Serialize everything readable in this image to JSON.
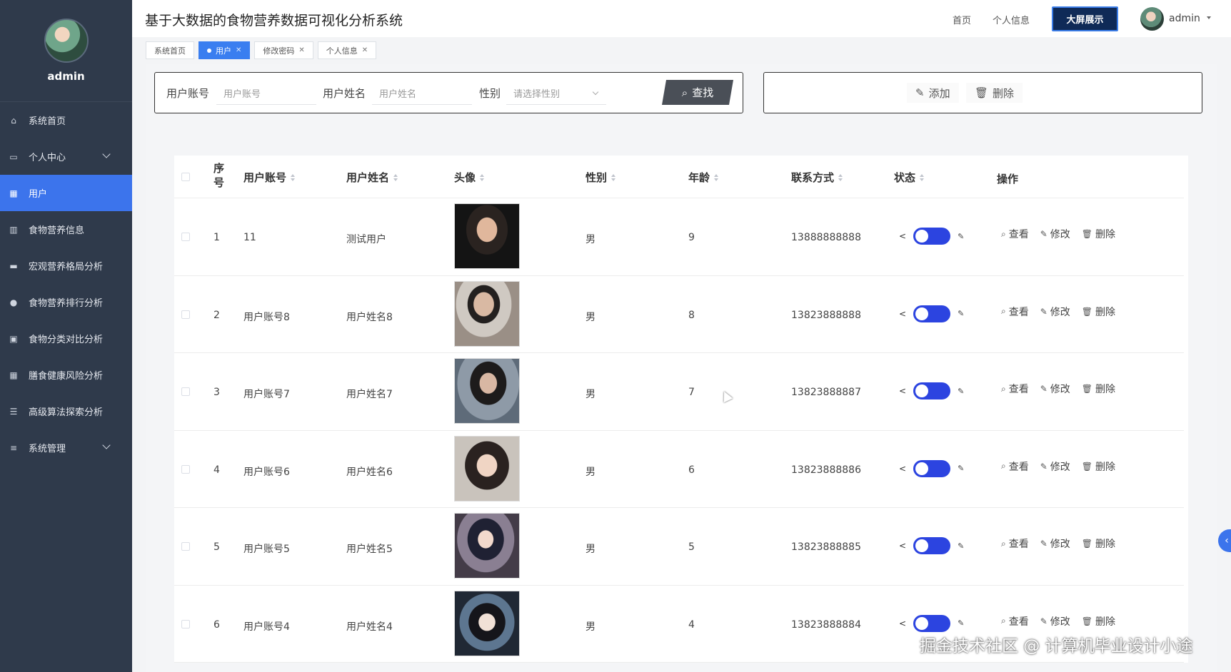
{
  "sidebar": {
    "username": "admin",
    "items": [
      {
        "label": "系统首页",
        "icon": "home-icon"
      },
      {
        "label": "个人中心",
        "icon": "id-card-icon",
        "expandable": true
      },
      {
        "label": "用户",
        "icon": "grid-icon",
        "active": true
      },
      {
        "label": "食物营养信息",
        "icon": "bar-chart-icon"
      },
      {
        "label": "宏观营养格局分析",
        "icon": "monitor-icon"
      },
      {
        "label": "食物营养排行分析",
        "icon": "location-icon"
      },
      {
        "label": "食物分类对比分析",
        "icon": "clipboard-icon"
      },
      {
        "label": "膳食健康风险分析",
        "icon": "grid-icon"
      },
      {
        "label": "高级算法探索分析",
        "icon": "list-icon"
      },
      {
        "label": "系统管理",
        "icon": "sliders-icon",
        "expandable": true
      }
    ]
  },
  "header": {
    "title": "基于大数据的食物营养数据可视化分析系统",
    "nav_home": "首页",
    "nav_profile": "个人信息",
    "big_screen_button": "大屏展示",
    "user_name": "admin"
  },
  "tabs": [
    {
      "label": "系统首页",
      "active": false,
      "closable": false
    },
    {
      "label": "用户",
      "active": true,
      "closable": true
    },
    {
      "label": "修改密码",
      "active": false,
      "closable": true
    },
    {
      "label": "个人信息",
      "active": false,
      "closable": true
    }
  ],
  "search": {
    "account_label": "用户账号",
    "account_placeholder": "用户账号",
    "name_label": "用户姓名",
    "name_placeholder": "用户姓名",
    "gender_label": "性别",
    "gender_placeholder": "请选择性别",
    "find_button": "查找"
  },
  "actions": {
    "add_button": "添加",
    "delete_button": "删除"
  },
  "table": {
    "headers": {
      "index": "序号",
      "account": "用户账号",
      "name": "用户姓名",
      "avatar": "头像",
      "gender": "性别",
      "age": "年龄",
      "contact": "联系方式",
      "status": "状态",
      "ops": "操作"
    },
    "op_labels": {
      "view": "查看",
      "edit": "修改",
      "delete": "删除"
    },
    "rows": [
      {
        "index": "1",
        "account": "11",
        "name": "测试用户",
        "gender": "男",
        "age": "9",
        "contact": "13888888888",
        "enabled": true
      },
      {
        "index": "2",
        "account": "用户账号8",
        "name": "用户姓名8",
        "gender": "男",
        "age": "8",
        "contact": "13823888888",
        "enabled": true
      },
      {
        "index": "3",
        "account": "用户账号7",
        "name": "用户姓名7",
        "gender": "男",
        "age": "7",
        "contact": "13823888887",
        "enabled": true
      },
      {
        "index": "4",
        "account": "用户账号6",
        "name": "用户姓名6",
        "gender": "男",
        "age": "6",
        "contact": "13823888886",
        "enabled": true
      },
      {
        "index": "5",
        "account": "用户账号5",
        "name": "用户姓名5",
        "gender": "男",
        "age": "5",
        "contact": "13823888885",
        "enabled": true
      },
      {
        "index": "6",
        "account": "用户账号4",
        "name": "用户姓名4",
        "gender": "男",
        "age": "4",
        "contact": "13823888884",
        "enabled": true
      }
    ]
  },
  "watermark": "掘金技术社区 @ 计算机毕业设计小途",
  "colors": {
    "sidebar_bg": "#2f3a4b",
    "accent": "#3c74ec",
    "toggle_on": "#2c44e0",
    "big_screen_bg": "#0f2a57"
  }
}
